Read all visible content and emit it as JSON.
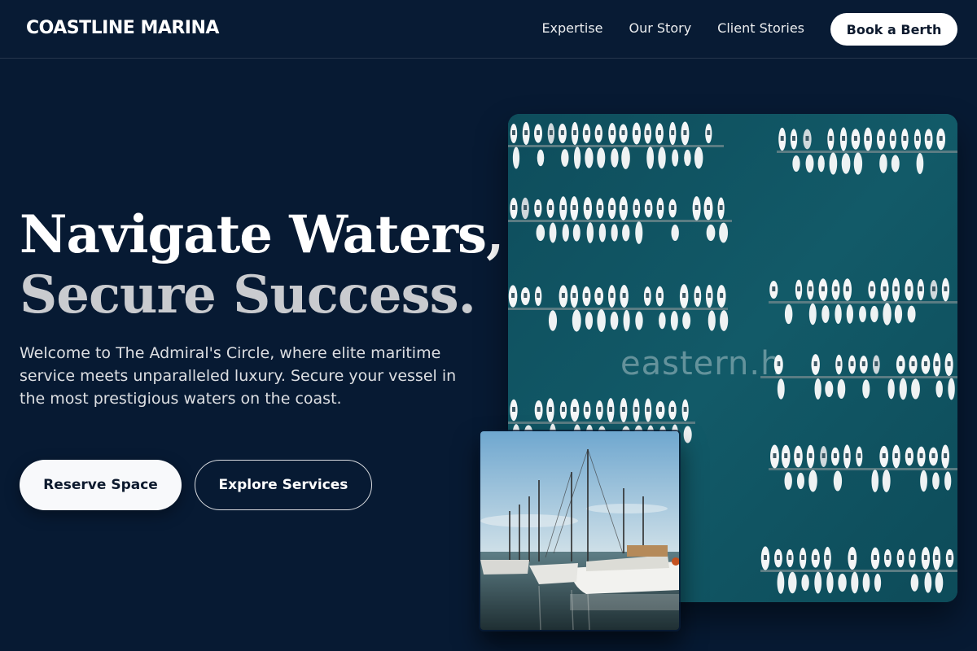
{
  "header": {
    "brand": "COASTLINE MARINA",
    "nav": [
      {
        "label": "Expertise"
      },
      {
        "label": "Our Story"
      },
      {
        "label": "Client Stories"
      }
    ],
    "cta_label": "Book a Berth"
  },
  "hero": {
    "title_line1": "Navigate Waters,",
    "title_line2": "Secure Success.",
    "subtitle": "Welcome to The Admiral's Circle, where elite maritime service meets unparalleled luxury. Secure your vessel in the most prestigious waters on the coast.",
    "primary_cta": "Reserve Space",
    "secondary_cta": "Explore Services"
  },
  "images": {
    "aerial_watermark": "eastern.h"
  },
  "colors": {
    "background": "#071a33",
    "title_primary": "#ffffff",
    "title_secondary": "#c9cbcf",
    "water": "#0f5663",
    "button_light": "#f8f9fb"
  }
}
